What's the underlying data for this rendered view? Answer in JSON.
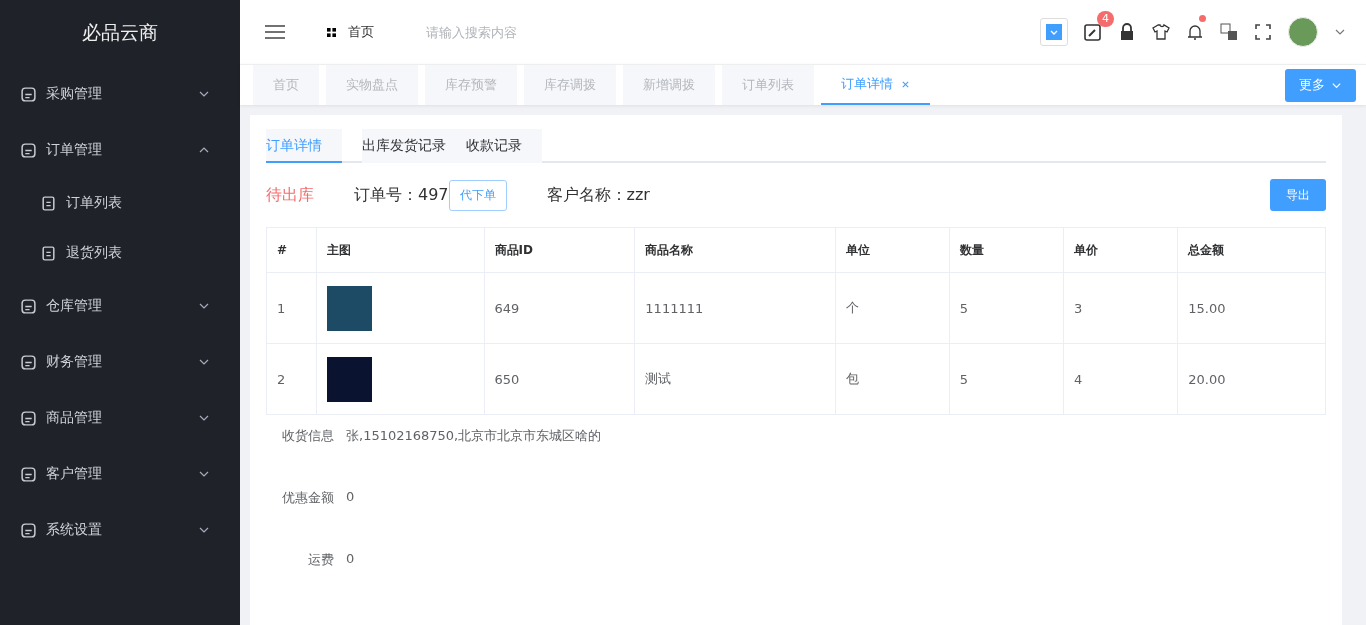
{
  "sidebar": {
    "logo": "必品云商",
    "items": [
      {
        "label": "采购管理",
        "expanded": false
      },
      {
        "label": "订单管理",
        "expanded": true,
        "children": [
          {
            "label": "订单列表"
          },
          {
            "label": "退货列表"
          }
        ]
      },
      {
        "label": "仓库管理",
        "expanded": false
      },
      {
        "label": "财务管理",
        "expanded": false
      },
      {
        "label": "商品管理",
        "expanded": false
      },
      {
        "label": "客户管理",
        "expanded": false
      },
      {
        "label": "系统设置",
        "expanded": false
      }
    ]
  },
  "header": {
    "breadcrumb": "首页",
    "search": {
      "placeholder": "请输入搜索内容"
    },
    "tool_badge": "4",
    "notification_unread": true
  },
  "page_tabs": [
    {
      "label": "首页",
      "selected": false
    },
    {
      "label": "实物盘点",
      "selected": false
    },
    {
      "label": "库存预警",
      "selected": false
    },
    {
      "label": "库存调拨",
      "selected": false
    },
    {
      "label": "新增调拨",
      "selected": false
    },
    {
      "label": "订单列表",
      "selected": false
    },
    {
      "label": "订单详情",
      "selected": true
    }
  ],
  "more_button": "更多",
  "detail_tabs": [
    {
      "label": "订单详情",
      "selected": true
    },
    {
      "label": "出库发货记录",
      "selected": false
    },
    {
      "label": "收款记录",
      "selected": false
    }
  ],
  "order": {
    "status": "待出库",
    "order_no": "订单号：497",
    "proxy_button": "代下单",
    "customer": "客户名称：zzr",
    "export_button": "导出"
  },
  "table": {
    "columns": [
      "#",
      "主图",
      "商品ID",
      "商品名称",
      "单位",
      "数量",
      "单价",
      "总金额"
    ],
    "rows": [
      {
        "index": "1",
        "id": "649",
        "name": "1111111",
        "unit": "个",
        "qty": "5",
        "price": "3",
        "total": "15.00"
      },
      {
        "index": "2",
        "id": "650",
        "name": "测试",
        "unit": "包",
        "qty": "5",
        "price": "4",
        "total": "20.00"
      }
    ]
  },
  "info": [
    {
      "label": "收货信息",
      "value": "张,15102168750,北京市北京市东城区啥的"
    },
    {
      "label": "优惠金额",
      "value": "0"
    },
    {
      "label": "运费",
      "value": "0"
    }
  ]
}
